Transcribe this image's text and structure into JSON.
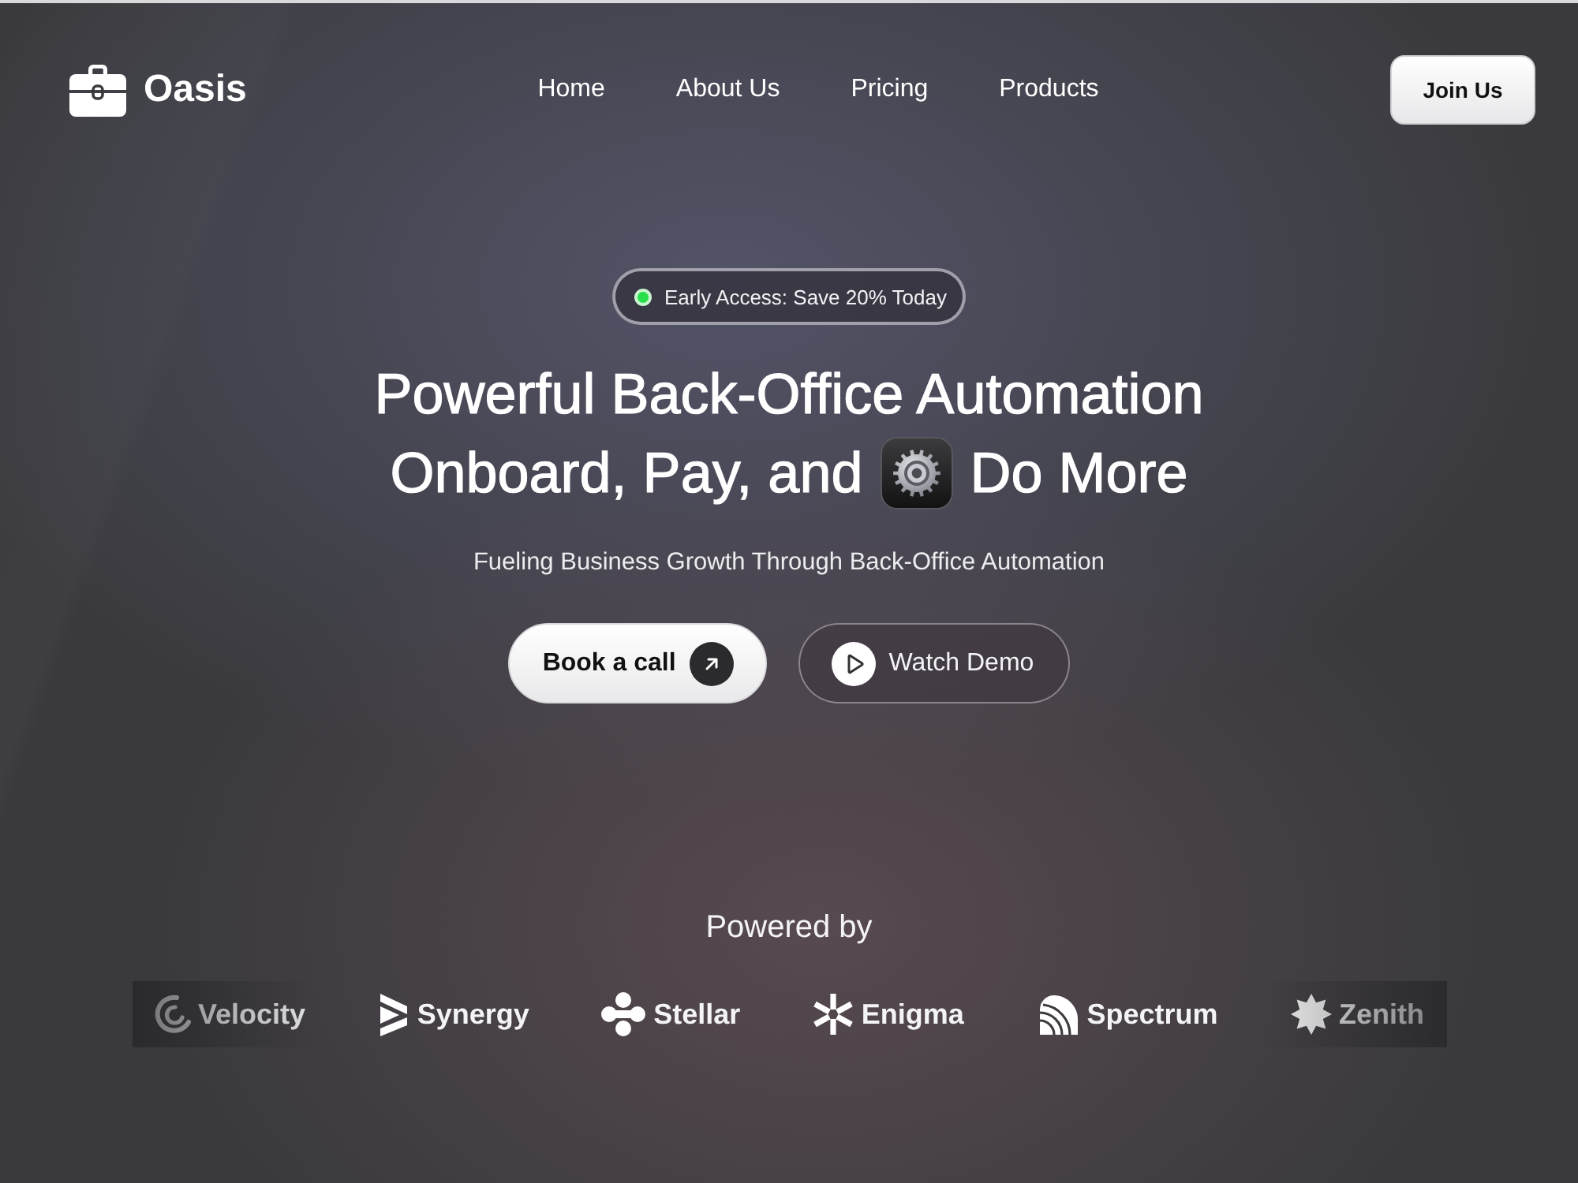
{
  "nav": {
    "brand": "Oasis",
    "links": [
      {
        "label": "Home"
      },
      {
        "label": "About Us"
      },
      {
        "label": "Pricing"
      },
      {
        "label": "Products"
      }
    ],
    "cta": "Join Us"
  },
  "hero": {
    "badge": "Early Access: Save 20% Today",
    "headline": [
      [
        {
          "kind": "text",
          "text": "Powerful Back-Office Automation"
        }
      ],
      [
        {
          "kind": "text",
          "text": "Onboard, Pay, and"
        },
        {
          "kind": "icon"
        },
        {
          "kind": "text",
          "text": "Do More"
        }
      ]
    ],
    "subtitle": "Fueling Business Growth Through Back-Office Automation",
    "buttons": [
      {
        "kind": "primary",
        "label": "Book a call"
      },
      {
        "kind": "secondary",
        "label": "Watch Demo"
      }
    ]
  },
  "partners": {
    "title": "Powered by",
    "logos": [
      {
        "kind": "swirl",
        "name": "Velocity"
      },
      {
        "kind": "stripes",
        "name": "Synergy"
      },
      {
        "kind": "clover",
        "name": "Stellar"
      },
      {
        "kind": "asterisk",
        "name": "Enigma"
      },
      {
        "kind": "fan",
        "name": "Spectrum"
      },
      {
        "kind": "star",
        "name": "Zenith"
      }
    ]
  }
}
